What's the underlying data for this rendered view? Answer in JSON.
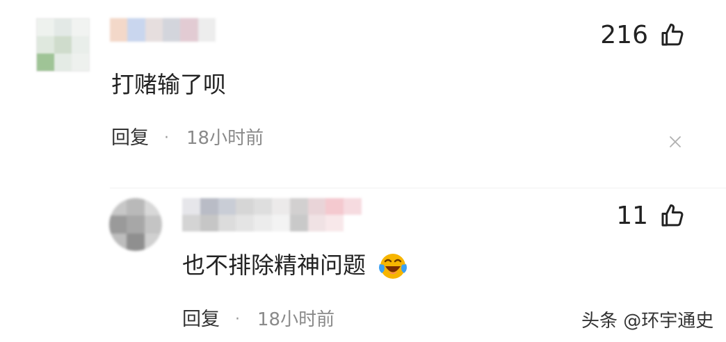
{
  "comments": [
    {
      "text": "打赌输了呗",
      "likes": "216",
      "reply_label": "回复",
      "separator": "·",
      "time": "18小时前",
      "icons": [
        "thumbs-up-icon",
        "close-icon"
      ]
    },
    {
      "text": "也不排除精神问题",
      "likes": "11",
      "reply_label": "回复",
      "separator": "·",
      "time": "18小时前",
      "icons": [
        "thumbs-up-icon",
        "laughing-crying-emoji-icon"
      ]
    }
  ],
  "watermark": "头条 @环宇通史",
  "colors": {
    "text": "#222222",
    "secondary_text": "#8a8a8a",
    "emoji_yellow": "#f7b500",
    "emoji_blue": "#3da0f2"
  }
}
